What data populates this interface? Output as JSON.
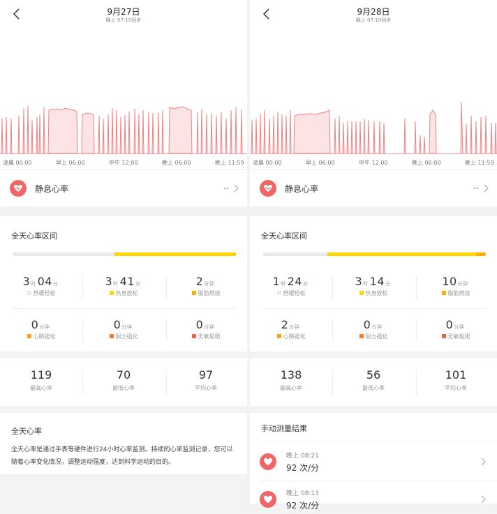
{
  "colors": {
    "accent": "#f06565",
    "zone_relax": "#e9e9e9",
    "zone_warmup": "#ffd700",
    "zone_fatburn": "#ffb100",
    "zone_cardio": "#ff9f1a",
    "zone_endurance": "#ff7a1f",
    "zone_anaerobic": "#ff5a3c"
  },
  "panels": [
    {
      "title": "9月27日",
      "subtitle": "晚上 07:10同步",
      "time_labels": [
        "凌晨 00:00",
        "早上 06:00",
        "中午 12:00",
        "晚上 06:00",
        "晚上 11:59"
      ],
      "resting": {
        "label": "静息心率",
        "value": "--"
      },
      "zones_title": "全天心率区间",
      "zone_bar": [
        {
          "color_key": "zone_relax",
          "start": 0,
          "end": 0.455
        },
        {
          "color_key": "zone_warmup",
          "start": 0.455,
          "end": 0.99
        },
        {
          "color_key": "zone_fatburn",
          "start": 0.99,
          "end": 1.0
        }
      ],
      "zones": [
        {
          "parts": [
            [
              "3",
              "时"
            ],
            [
              "04",
              "分"
            ]
          ],
          "label": "舒缓轻松",
          "color_key": "zone_relax"
        },
        {
          "parts": [
            [
              "3",
              "时"
            ],
            [
              "41",
              "分"
            ]
          ],
          "label": "热身放松",
          "color_key": "zone_warmup"
        },
        {
          "parts": [
            [
              "2",
              "分钟"
            ]
          ],
          "label": "脂肪燃烧",
          "color_key": "zone_fatburn"
        },
        {
          "parts": [
            [
              "0",
              "分钟"
            ]
          ],
          "label": "心肺强化",
          "color_key": "zone_cardio"
        },
        {
          "parts": [
            [
              "0",
              "分钟"
            ]
          ],
          "label": "耐力强化",
          "color_key": "zone_endurance"
        },
        {
          "parts": [
            [
              "0",
              "分钟"
            ]
          ],
          "label": "无氧极限",
          "color_key": "zone_anaerobic"
        }
      ],
      "stats": [
        {
          "value": "119",
          "label": "最高心率"
        },
        {
          "value": "70",
          "label": "最低心率"
        },
        {
          "value": "97",
          "label": "平均心率"
        }
      ],
      "description": {
        "title": "全天心率",
        "text": "全天心率是通过手表等硬件进行24小时心率监测。持续的心率监测记录，您可以随着心率变化情况，调整运动强度，达到科学运动的目的。"
      }
    },
    {
      "title": "9月28日",
      "subtitle": "晚上 07:10同步",
      "time_labels": [
        "凌晨 00:00",
        "早上 06:00",
        "中午 12:00",
        "晚上 06:00",
        "晚上 11:59"
      ],
      "resting": {
        "label": "静息心率",
        "value": "--"
      },
      "zones_title": "全天心率区间",
      "zone_bar": [
        {
          "color_key": "zone_relax",
          "start": 0,
          "end": 0.29
        },
        {
          "color_key": "zone_warmup",
          "start": 0.29,
          "end": 0.955
        },
        {
          "color_key": "zone_fatburn",
          "start": 0.955,
          "end": 0.99
        },
        {
          "color_key": "zone_cardio",
          "start": 0.99,
          "end": 1.0
        }
      ],
      "zones": [
        {
          "parts": [
            [
              "1",
              "时"
            ],
            [
              "24",
              "分"
            ]
          ],
          "label": "舒缓轻松",
          "color_key": "zone_relax"
        },
        {
          "parts": [
            [
              "3",
              "时"
            ],
            [
              "14",
              "分"
            ]
          ],
          "label": "热身放松",
          "color_key": "zone_warmup"
        },
        {
          "parts": [
            [
              "10",
              "分钟"
            ]
          ],
          "label": "脂肪燃烧",
          "color_key": "zone_fatburn"
        },
        {
          "parts": [
            [
              "2",
              "分钟"
            ]
          ],
          "label": "心肺强化",
          "color_key": "zone_cardio"
        },
        {
          "parts": [
            [
              "0",
              "分钟"
            ]
          ],
          "label": "耐力强化",
          "color_key": "zone_endurance"
        },
        {
          "parts": [
            [
              "0",
              "分钟"
            ]
          ],
          "label": "无氧极限",
          "color_key": "zone_anaerobic"
        }
      ],
      "stats": [
        {
          "value": "138",
          "label": "最高心率"
        },
        {
          "value": "56",
          "label": "最低心率"
        },
        {
          "value": "101",
          "label": "平均心率"
        }
      ],
      "manual": {
        "title": "手动测量结果",
        "items": [
          {
            "time": "晚上 08:21",
            "bpm": "92 次/分"
          },
          {
            "time": "晚上 08:13",
            "bpm": "92 次/分"
          }
        ]
      }
    }
  ],
  "icons": {
    "back": "chevron-left-icon",
    "heart": "heart-icon",
    "chevron": "chevron-right-icon"
  }
}
